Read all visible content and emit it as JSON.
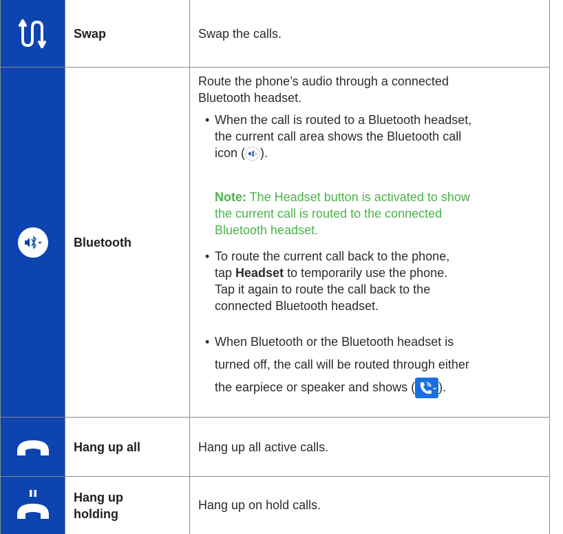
{
  "rows": [
    {
      "icon": "swap-arrows-icon",
      "name": "Swap",
      "description": "Swap the calls."
    },
    {
      "icon": "bluetooth-speaker-icon",
      "name": "Bluetooth",
      "intro_line1": "Route the phone’s audio through a connected",
      "intro_line2": "Bluetooth headset.",
      "bullet1_line1": "When the call is routed to a Bluetooth headset,",
      "bullet1_line2": "the current call area shows the Bluetooth call",
      "bullet1_line3_pre": "icon (",
      "bullet1_line3_post": ").",
      "note_label": "Note:",
      "note_line1": " The Headset button is activated to show",
      "note_line2": "the current call is routed to the connected",
      "note_line3": "Bluetooth headset.",
      "bullet2_line1_pre": "To route the current call back to the phone,",
      "bullet2_line2_pre": "tap ",
      "bullet2_line2_bold": "Headset",
      "bullet2_line2_post": " to temporarily use the phone.",
      "bullet2_line3": "Tap it again to route the call back to the",
      "bullet2_line4": "connected Bluetooth headset.",
      "bullet3_line1": "When Bluetooth or the Bluetooth headset is",
      "bullet3_line2": "turned off, the call will be routed through either",
      "bullet3_line3_pre": "the earpiece or speaker and shows (",
      "bullet3_line3_post": ")."
    },
    {
      "icon": "hang-up-icon",
      "name": "Hang up all",
      "description": "Hang up all active calls."
    },
    {
      "icon": "hang-up-holding-icon",
      "name_line1": "Hang up",
      "name_line2": "holding",
      "description": "Hang up on hold calls."
    }
  ],
  "bullet": "•",
  "colors": {
    "icon_bg": "#0d44b0",
    "note": "#4bb24b",
    "border": "#8a8a8a"
  }
}
